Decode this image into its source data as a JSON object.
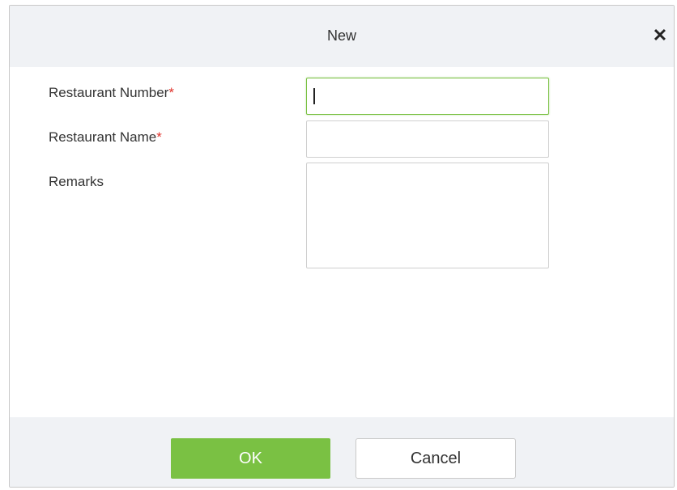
{
  "dialog": {
    "title": "New",
    "close_icon": "close-icon",
    "close_glyph": "✕"
  },
  "form": {
    "restaurant_number": {
      "label": "Restaurant Number",
      "required_mark": "*",
      "value": "",
      "focused": true
    },
    "restaurant_name": {
      "label": "Restaurant Name",
      "required_mark": "*",
      "value": ""
    },
    "remarks": {
      "label": "Remarks",
      "value": ""
    }
  },
  "footer": {
    "ok_label": "OK",
    "cancel_label": "Cancel"
  },
  "colors": {
    "accent": "#7ac143",
    "required": "#e0322b",
    "header_bg": "#f0f2f5"
  }
}
